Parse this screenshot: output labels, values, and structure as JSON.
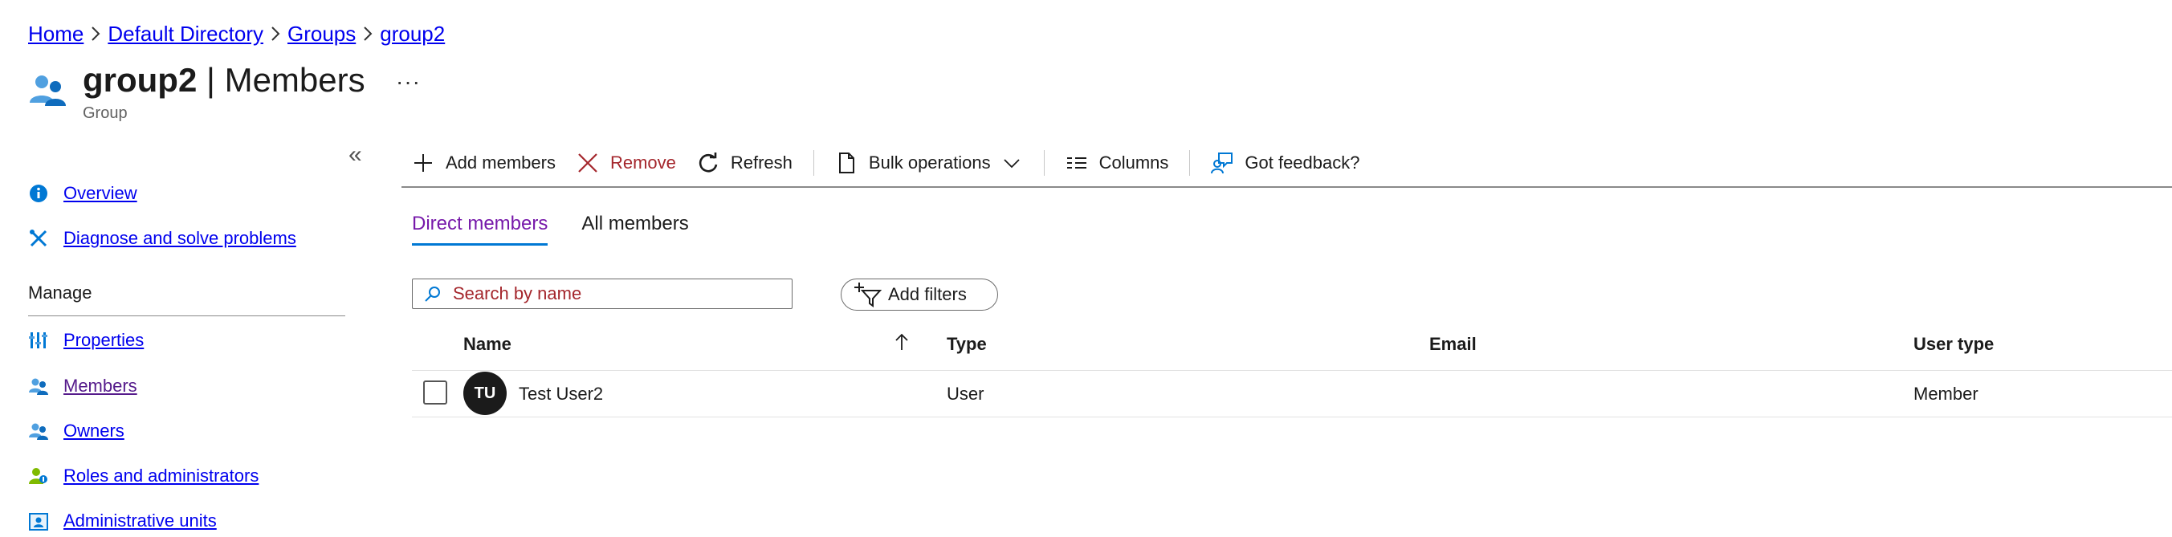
{
  "breadcrumb": {
    "items": [
      "Home",
      "Default Directory",
      "Groups",
      "group2"
    ]
  },
  "header": {
    "title_bold": "group2",
    "title_rest": " | Members",
    "subtitle": "Group",
    "more": "···"
  },
  "sidebar": {
    "collapse": "«",
    "overview": "Overview",
    "diagnose": "Diagnose and solve problems",
    "manage_label": "Manage",
    "properties": "Properties",
    "members": "Members",
    "owners": "Owners",
    "roles": "Roles and administrators",
    "admin_units": "Administrative units"
  },
  "toolbar": {
    "add_members": "Add members",
    "remove": "Remove",
    "refresh": "Refresh",
    "bulk_operations": "Bulk operations",
    "columns": "Columns",
    "feedback": "Got feedback?"
  },
  "tabs": {
    "direct": "Direct members",
    "all": "All members"
  },
  "search": {
    "placeholder": "Search by name"
  },
  "filters": {
    "add_filters": "Add filters"
  },
  "table": {
    "columns": [
      "Name",
      "Type",
      "Email",
      "User type"
    ],
    "rows": [
      {
        "initials": "TU",
        "name": "Test User2",
        "type": "User",
        "email": "",
        "user_type": "Member"
      }
    ]
  },
  "colors": {
    "accent": "#0078d4",
    "active_tab": "#7719aa",
    "danger": "#a4262c"
  }
}
